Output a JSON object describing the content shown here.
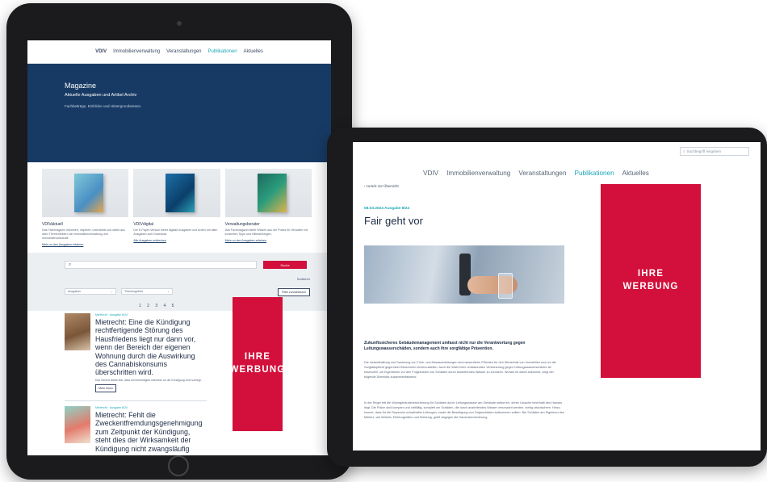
{
  "left_tablet": {
    "nav": {
      "logo": "VDIV",
      "items": [
        "Immobilienverwaltung",
        "Veranstaltungen",
        "Publikationen",
        "Aktuelles"
      ],
      "active": "Publikationen"
    },
    "hero": {
      "title": "Magazine",
      "subtitle": "Aktuelle Ausgaben und Artikel Archiv",
      "tagline": "Fachbeiträge, Einblicke und Hintergrundwissen."
    },
    "magazines": [
      {
        "name": "VDIVaktuell",
        "text": "Das Fachmagazin informiert, inspiriert, unterstützt und stärkt aus allen Themenfeldern der Immobilienverwaltung und Immobilienwirtschaft.",
        "link": "Mehr zu den Ausgaben erfahren"
      },
      {
        "name": "VDIVdigital",
        "text": "Die E-Paper-Version bietet digitale Ausgaben und Archiv mit allen Ausgaben zum Download.",
        "link": "Alle Ausgaben entdecken"
      },
      {
        "name": "Verwaltungsberater",
        "text": "Das Fachmagazin bietet Wissen aus der Praxis für Verwalter mit konkreten Tipps und Hilfestellungen.",
        "link": "Mehr zu den Ausgaben erfahren"
      }
    ],
    "search": {
      "button": "Suche",
      "sort_label": "Sortieren",
      "filter1": "Ausgaben",
      "filter2": "Themengebiet",
      "reset": "Filter zurücksetzen"
    },
    "pager": "1 2 3 4 5",
    "articles": [
      {
        "meta": "Mietrecht · Ausgabe 8/24",
        "title": "Mietrecht: Eine die Kündigung rechtfertigende Störung des Hausfriedens liegt nur dann vor, wenn der Bereich der eigenen Wohnung durch die Auswirkung des Cannabiskonsums überschritten wird.",
        "desc": "Das Gericht stellte fest, dass ein berechtigtes Interesse an der Kündigung nicht vorliegt.",
        "button": "Mehr lesen"
      },
      {
        "meta": "Mietrecht · Ausgabe 8/24",
        "title": "Mietrecht: Fehlt die Zweckentfremdungsgenehmigung zum Zeitpunkt der Kündigung, steht dies der Wirksamkeit der Kündigung nicht zwangsläufig",
        "desc": "",
        "button": ""
      }
    ],
    "ad": {
      "line1": "IHRE",
      "line2": "WERBUNG"
    }
  },
  "right_tablet": {
    "search_placeholder": "Suchbegriff eingeben",
    "nav": {
      "items": [
        "VDIV",
        "Immobilienverwaltung",
        "Veranstaltungen",
        "Publikationen",
        "Aktuelles"
      ],
      "active": "Publikationen"
    },
    "back_link": "‹ zurück zur Übersicht",
    "meta": "08.03.2024 Ausgabe 8/24",
    "title": "Fair geht vor",
    "lead": "Zukunftssicheres Gebäudemanagement umfasst nicht nur die Verantwortung gegen Leitungswasserschäden, sondern auch ihre sorgfältige Prävention.",
    "body1": "Die Instandhaltung und Sanierung von Trink- und Abwasserleitungen sind wesentliche Pflichten für den Werterhalt von Immobilien und um die Sorgfaltspflicht gegenüber Bewohnern sicherzustellen. Auch die Wahl einer umfassenden Versicherung gegen Leitungswasserschäden ist essenziell, um Eigentümer vor den Folgekosten von Schäden durch austretendes Wasser zu schützen. Worauf es dabei ankommt, zeigt der folgende Überblick zusammenfassend.",
    "body2": "In der Regel tritt die Wohngebäudeversicherung für Schäden durch Leitungswasser am Gebäude selbst ein, deren Ursache innerhalb des Hauses liegt. Die Police sind komplex und vielfältig, komplett um Schäden, die durch austretendes Wasser verursacht werden, richtig abzusichern. Hinzu kommt, dass für die Reparatur schadhafter Leitungen, sowie die Beseitigung von Folgeschäden aufkommen sollten. Bei Schäden am Eigentum des Mieters, wie Möbeln, Elektrogeräten und Kleidung, greift dagegen die Hausratversicherung.",
    "ad": {
      "line1": "IHRE",
      "line2": "WERBUNG"
    }
  }
}
